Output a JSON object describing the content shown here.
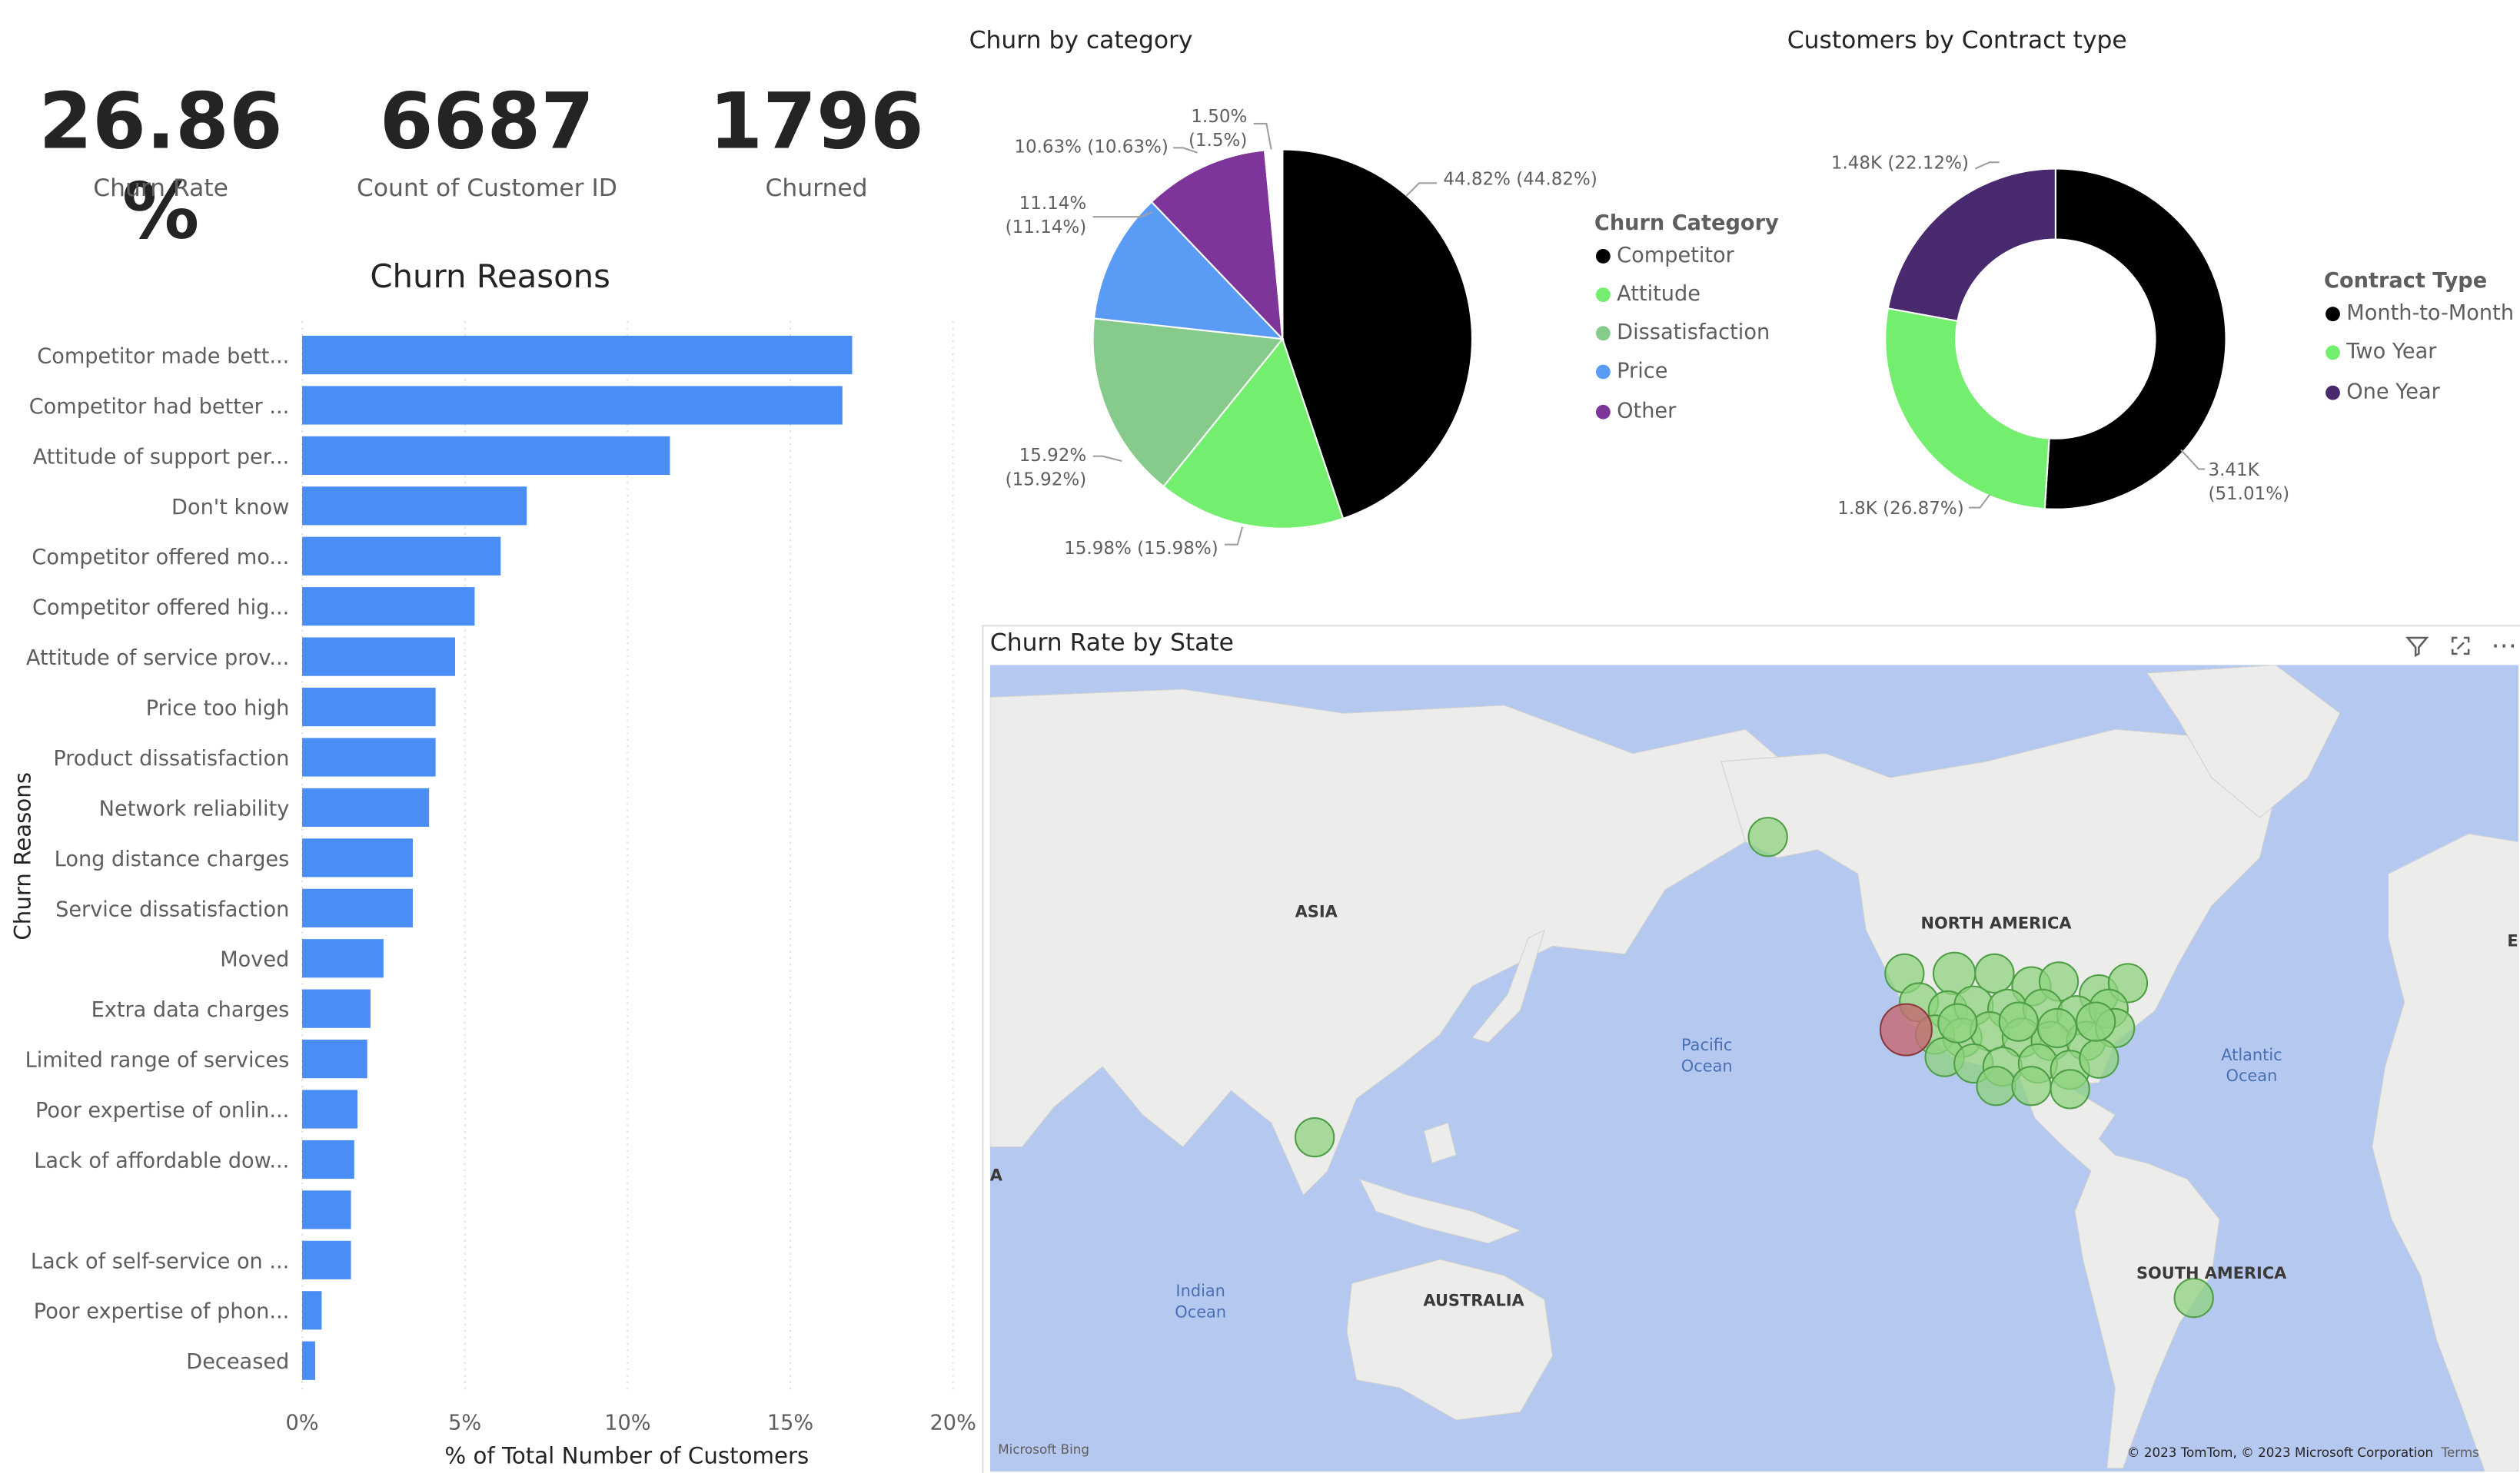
{
  "kpis": {
    "churn_rate": {
      "value": "26.86 %",
      "label": "Churn Rate"
    },
    "customers": {
      "value": "6687",
      "label": "Count of Customer ID"
    },
    "churned": {
      "value": "1796",
      "label": "Churned"
    }
  },
  "bar_chart": {
    "title": "Churn Reasons",
    "xlabel": "% of Total Number of Customers",
    "ylabel": "Churn Reasons",
    "ticks": [
      "0%",
      "5%",
      "10%",
      "15%",
      "20%"
    ],
    "color": "#4a8ef5"
  },
  "pie_chart": {
    "title": "Churn by category",
    "legend_title": "Churn Category",
    "labels": {
      "competitor": "44.82% (44.82%)",
      "attitude": "15.98% (15.98%)",
      "dissatisfaction_l1": "15.92%",
      "dissatisfaction_l2": "(15.92%)",
      "price_l1": "11.14%",
      "price_l2": "(11.14%)",
      "other": "10.63% (10.63%)",
      "unknown_l1": "1.50%",
      "unknown_l2": "(1.5%)"
    },
    "legend": [
      "Competitor",
      "Attitude",
      "Dissatisfaction",
      "Price",
      "Other"
    ]
  },
  "donut_chart": {
    "title": "Customers by Contract type",
    "legend_title": "Contract Type",
    "labels": {
      "mtm_l1": "3.41K",
      "mtm_l2": "(51.01%)",
      "two_year": "1.8K (26.87%)",
      "one_year": "1.48K (22.12%)"
    },
    "legend": [
      "Month-to-Month",
      "Two Year",
      "One Year"
    ]
  },
  "map": {
    "title": "Churn Rate by State",
    "labels": {
      "asia": "ASIA",
      "north_america": "NORTH AMERICA",
      "south_america": "SOUTH AMERICA",
      "australia": "AUSTRALIA",
      "pacific_1": "Pacific",
      "pacific_2": "Ocean",
      "atlantic_1": "Atlantic",
      "atlantic_2": "Ocean",
      "indian_1": "Indian",
      "indian_2": "Ocean",
      "edge_a": "A",
      "edge_e": "E"
    },
    "attribution": "© 2023 TomTom, © 2023 Microsoft Corporation",
    "terms": "Terms",
    "bing": "Microsoft Bing"
  },
  "chart_data": [
    {
      "type": "bar",
      "title": "Churn Reasons",
      "xlabel": "% of Total Number of Customers",
      "ylabel": "Churn Reasons",
      "xlim": [
        0,
        20
      ],
      "categories": [
        "Competitor made bett...",
        "Competitor had better ...",
        "Attitude of support per...",
        "Don't know",
        "Competitor offered mo...",
        "Competitor offered hig...",
        "Attitude of service prov...",
        "Price too high",
        "Product dissatisfaction",
        "Network reliability",
        "Long distance charges",
        "Service dissatisfaction",
        "Moved",
        "Extra data charges",
        "Limited range of services",
        "Poor expertise of onlin...",
        "Lack of affordable dow...",
        "",
        "Lack of self-service on ...",
        "Poor expertise of phon...",
        "Deceased"
      ],
      "values": [
        16.9,
        16.6,
        11.3,
        6.9,
        6.1,
        5.3,
        4.7,
        4.1,
        4.1,
        3.9,
        3.4,
        3.4,
        2.5,
        2.1,
        2.0,
        1.7,
        1.6,
        1.5,
        1.5,
        0.6,
        0.4
      ]
    },
    {
      "type": "pie",
      "title": "Churn by category",
      "categories": [
        "Competitor",
        "Attitude",
        "Dissatisfaction",
        "Price",
        "Other",
        ""
      ],
      "values": [
        44.82,
        15.98,
        15.92,
        11.14,
        10.63,
        1.5
      ],
      "colors": [
        "#000000",
        "#74ee6f",
        "#86cb8c",
        "#5a9cf5",
        "#7d3599",
        "#ffffff"
      ]
    },
    {
      "type": "pie",
      "title": "Customers by Contract type",
      "categories": [
        "Month-to-Month",
        "Two Year",
        "One Year"
      ],
      "values": [
        51.01,
        26.87,
        22.12
      ],
      "colors": [
        "#000000",
        "#74ee6f",
        "#4a2a6e"
      ]
    }
  ]
}
